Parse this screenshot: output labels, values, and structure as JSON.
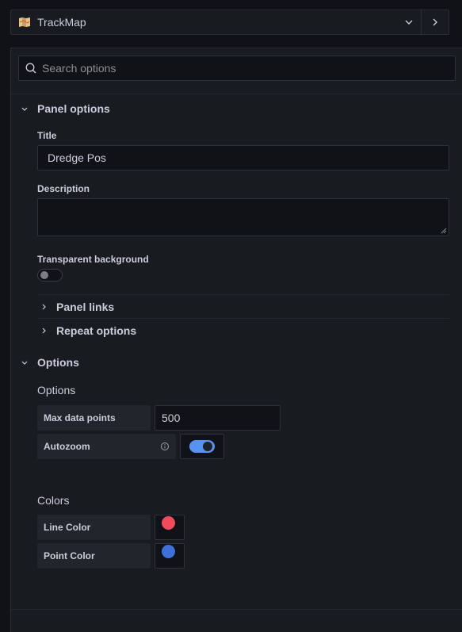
{
  "header": {
    "viz_name": "TrackMap",
    "viz_icon": "map-icon",
    "dropdown_icon": "chevron-down-icon",
    "next_icon": "chevron-right-icon"
  },
  "search": {
    "placeholder": "Search options",
    "icon": "search-icon"
  },
  "panel_options": {
    "title": "Panel options",
    "title_label": "Title",
    "title_value": "Dredge Pos",
    "description_label": "Description",
    "description_value": "",
    "transparent_label": "Transparent background",
    "transparent_on": false,
    "panel_links_label": "Panel links",
    "repeat_options_label": "Repeat options"
  },
  "options": {
    "title": "Options",
    "group_title": "Options",
    "max_points_label": "Max data points",
    "max_points_value": "500",
    "autozoom_label": "Autozoom",
    "autozoom_on": true,
    "colors_title": "Colors",
    "line_color_label": "Line Color",
    "point_color_label": "Point Color"
  },
  "colors": {
    "line_color": "#f2495c",
    "point_color": "#3d71d9",
    "toggle_on": "#5794f2",
    "background": "#181b1f",
    "page": "#111217"
  }
}
